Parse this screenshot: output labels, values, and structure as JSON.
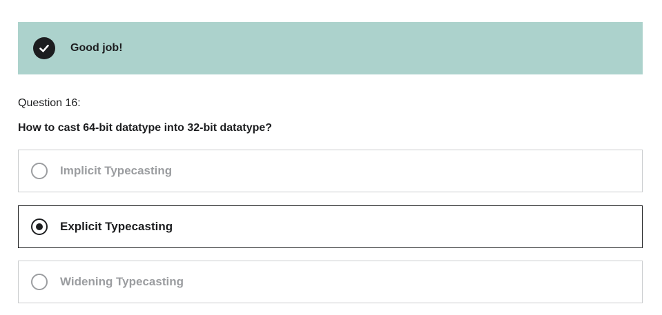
{
  "banner": {
    "message": "Good job!",
    "icon": "check-circle-icon",
    "background_color": "#acd2cc"
  },
  "question": {
    "number_label": "Question 16:",
    "text": "How to cast 64-bit datatype into 32-bit datatype?"
  },
  "options": [
    {
      "label": "Implicit Typecasting",
      "selected": false
    },
    {
      "label": "Explicit Typecasting",
      "selected": true
    },
    {
      "label": "Widening Typecasting",
      "selected": false
    }
  ]
}
